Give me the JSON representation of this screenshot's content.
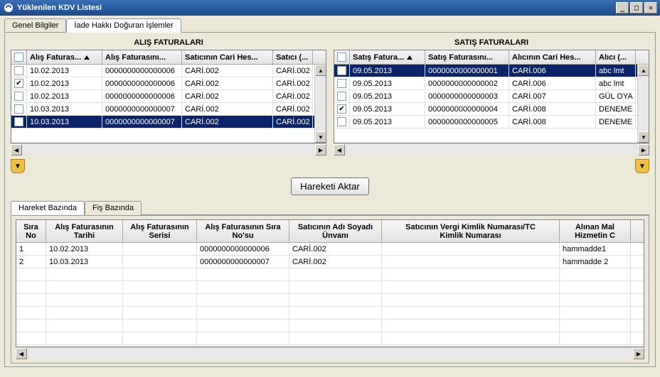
{
  "window": {
    "title": "Yüklenilen KDV Listesi"
  },
  "main_tabs": {
    "tab0": "Genel Bilgiler",
    "tab1": "İade Hakkı Doğuran İşlemler"
  },
  "left": {
    "title": "ALIŞ FATURALARI",
    "headers": {
      "date": "Alış Faturas...",
      "no": "Alış Faturasını...",
      "cari": "Satıcının Cari Hes...",
      "unvan": "Satıcı (..."
    },
    "rows": [
      {
        "checked": false,
        "date": "10.02.2013",
        "no": "0000000000000006",
        "cari": "CARİ.002",
        "unvan": "CARİ.002"
      },
      {
        "checked": true,
        "date": "10.02.2013",
        "no": "0000000000000006",
        "cari": "CARİ.002",
        "unvan": "CARİ.002"
      },
      {
        "checked": false,
        "date": "10.02.2013",
        "no": "0000000000000006",
        "cari": "CARİ.002",
        "unvan": "CARİ.002"
      },
      {
        "checked": false,
        "date": "10.03.2013",
        "no": "0000000000000007",
        "cari": "CARİ.002",
        "unvan": "CARİ.002"
      },
      {
        "checked": false,
        "date": "10.03.2013",
        "no": "0000000000000007",
        "cari": "CARİ.002",
        "unvan": "CARİ.002",
        "selected": true
      }
    ]
  },
  "right": {
    "title": "SATIŞ FATURALARI",
    "headers": {
      "date": "Satış Fatura...",
      "no": "Satış Faturasını...",
      "cari": "Alıcının Cari Hes...",
      "unvan": "Alıcı (..."
    },
    "rows": [
      {
        "checked": false,
        "date": "09.05.2013",
        "no": "0000000000000001",
        "cari": "CARİ.006",
        "unvan": "abc lmt",
        "selected": true
      },
      {
        "checked": false,
        "date": "09.05.2013",
        "no": "0000000000000002",
        "cari": "CARİ.006",
        "unvan": "abc lmt"
      },
      {
        "checked": false,
        "date": "09.05.2013",
        "no": "0000000000000003",
        "cari": "CARİ.007",
        "unvan": "GÜL OYA"
      },
      {
        "checked": true,
        "date": "09.05.2013",
        "no": "0000000000000004",
        "cari": "CARİ.008",
        "unvan": "DENEME"
      },
      {
        "checked": false,
        "date": "09.05.2013",
        "no": "0000000000000005",
        "cari": "CARİ.008",
        "unvan": "DENEME"
      }
    ]
  },
  "transfer_button": "Hareketi Aktar",
  "lower_tabs": {
    "tab0": "Hareket Bazında",
    "tab1": "Fiş Bazında"
  },
  "lower": {
    "headers": {
      "sira": "Sıra\nNo",
      "tarih": "Alış Faturasının\nTarihi",
      "seri": "Alış Faturasının\nSerisi",
      "sirano": "Alış Faturasının Sıra\nNo'su",
      "unvan": "Satıcının Adı Soyadı\nÜnvanı",
      "vergi": "Satıcının Vergi Kimlik Numarası/TC\nKimlik Numarası",
      "mal": "Alınan Mal\nHizmetin C"
    },
    "rows": [
      {
        "sira": "1",
        "tarih": "10.02.2013",
        "seri": "",
        "sirano": "0000000000000006",
        "unvan": "CARİ.002",
        "vergi": "",
        "mal": "hammadde1"
      },
      {
        "sira": "2",
        "tarih": "10.03.2013",
        "seri": "",
        "sirano": "0000000000000007",
        "unvan": "CARİ.002",
        "vergi": "",
        "mal": "hammadde 2"
      }
    ]
  }
}
